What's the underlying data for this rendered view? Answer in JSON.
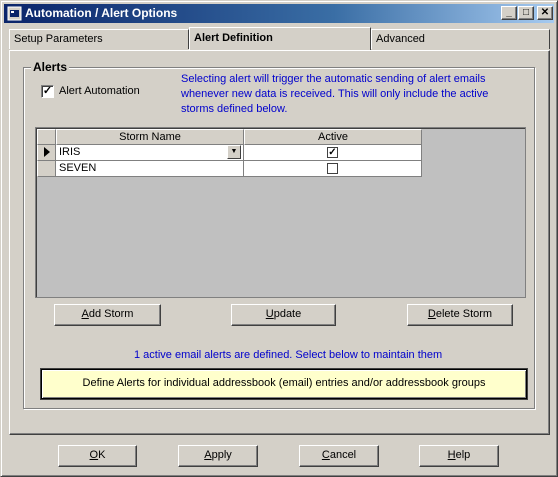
{
  "window": {
    "title": "Automation / Alert Options"
  },
  "tabs": [
    {
      "label": "Setup Parameters"
    },
    {
      "label": "Alert Definition"
    },
    {
      "label": "Advanced"
    }
  ],
  "alerts": {
    "group_label": "Alerts",
    "automation_label": "Alert Automation",
    "automation_checked": true,
    "info_line1": "Selecting alert will trigger the automatic sending of alert emails",
    "info_line2": "whenever new data is received.  This will only include the active",
    "info_line3": "storms defined below.",
    "columns": [
      "Storm Name",
      "Active"
    ],
    "rows": [
      {
        "name": "IRIS",
        "active": true,
        "current": true
      },
      {
        "name": "SEVEN",
        "active": false,
        "current": false
      }
    ],
    "add_label": "Add Storm",
    "add_accel": "A",
    "add_rest": "dd Storm",
    "update_accel": "U",
    "update_rest": "pdate",
    "delete_accel": "D",
    "delete_rest": "elete Storm",
    "status": "1 active email alerts are defined.  Select below to maintain them",
    "define_label": "Define Alerts for individual addressbook (email) entries and/or addressbook groups"
  },
  "footer": {
    "ok_accel": "O",
    "ok_rest": "K",
    "apply_accel": "A",
    "apply_rest": "pply",
    "cancel_accel": "C",
    "cancel_rest": "ancel",
    "help_accel": "H",
    "help_rest": "elp"
  },
  "colors": {
    "title_bar": "#0a246a",
    "info_text": "#0000cc",
    "define_button": "#ffffcc"
  }
}
